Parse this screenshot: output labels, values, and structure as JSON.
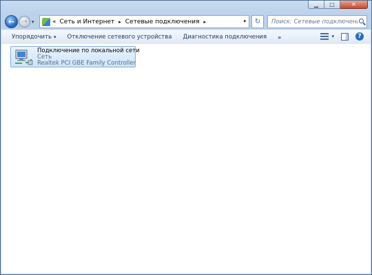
{
  "window": {
    "caption_buttons": {
      "minimize": "▁",
      "maximize": "□",
      "close": "✕"
    }
  },
  "nav": {
    "back": "←",
    "forward": "→",
    "history_dropdown": "▾",
    "breadcrumb": {
      "overflow": "«",
      "items": [
        "Сеть и Интернет",
        "Сетевые подключения"
      ],
      "separator": "▸",
      "dropdown": "▾"
    },
    "refresh": "↻",
    "search": {
      "placeholder": "Поиск: Сетевые подключения"
    }
  },
  "toolbar": {
    "organize": "Упорядочить",
    "organize_arrow": "▾",
    "disable_device": "Отключение сетевого устройства",
    "diagnose": "Диагностика подключения",
    "more": "»",
    "views_arrow": "▾",
    "help": "?"
  },
  "connection": {
    "name": "Подключение по локальной сети",
    "network": "Сеть",
    "adapter": "Realtek PCI GBE Family Controller",
    "icon": "network-adapter-icon"
  },
  "colors": {
    "selection_border": "#84acdd",
    "chrome": "#bcd2ec",
    "command_text": "#1e395b"
  }
}
